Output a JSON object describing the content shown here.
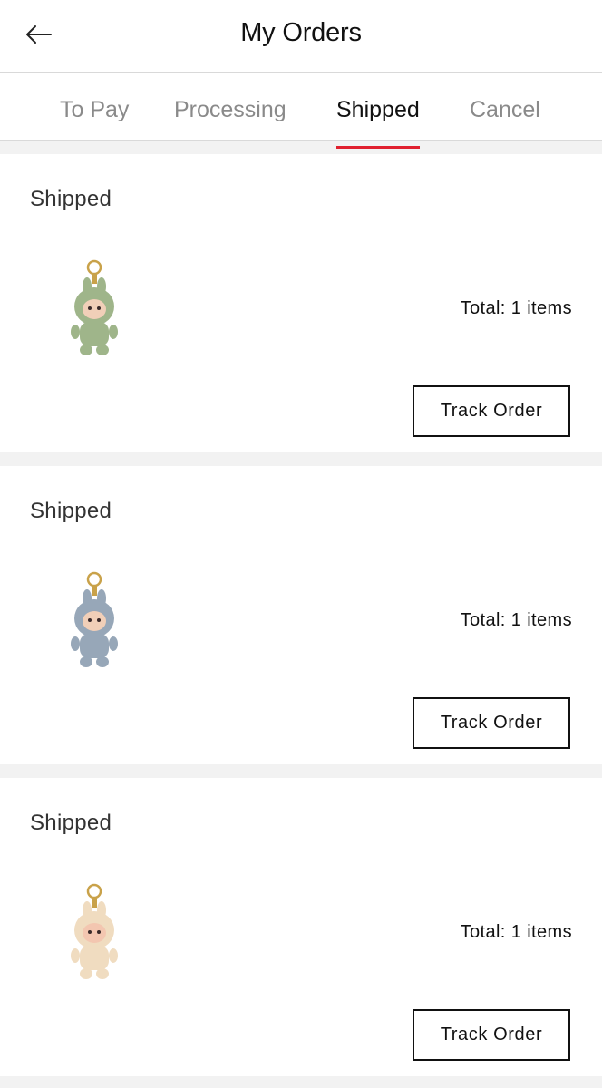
{
  "header": {
    "title": "My Orders",
    "back_icon": "arrow-left-icon"
  },
  "tabs": [
    {
      "label": "To Pay",
      "active": false
    },
    {
      "label": "Processing",
      "active": false
    },
    {
      "label": "Shipped",
      "active": true
    },
    {
      "label": "Cancel",
      "active": false
    }
  ],
  "colors": {
    "accent": "#e0202e",
    "background": "#f2f2f2",
    "card": "#ffffff",
    "text": "#111111",
    "muted_text": "#8a8a8a"
  },
  "orders": [
    {
      "status": "Shipped",
      "total_text": "Total: 1 items",
      "action_label": "Track Order",
      "product_icon": "plush-keychain-green-icon",
      "product_color": "#9fb58a"
    },
    {
      "status": "Shipped",
      "total_text": "Total: 1 items",
      "action_label": "Track Order",
      "product_icon": "plush-keychain-blue-icon",
      "product_color": "#97a7b8"
    },
    {
      "status": "Shipped",
      "total_text": "Total: 1 items",
      "action_label": "Track Order",
      "product_icon": "plush-keychain-cream-icon",
      "product_color": "#f0dcc0"
    }
  ]
}
